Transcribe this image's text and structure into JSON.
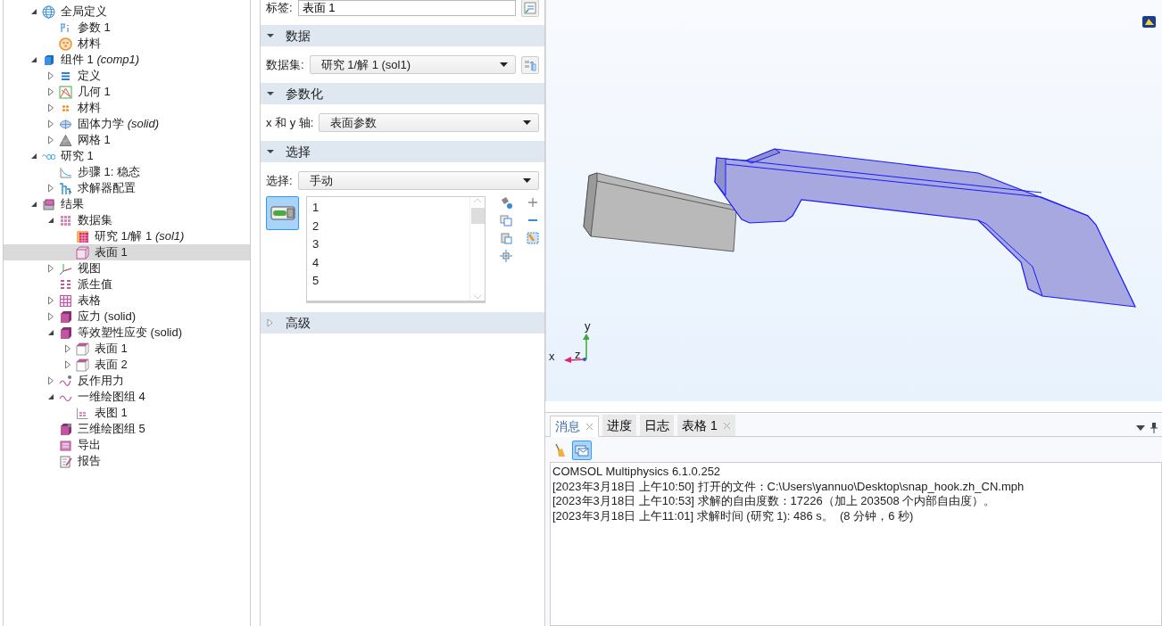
{
  "tree": [
    {
      "label": "全局定义",
      "kind": "globe",
      "expanded": true,
      "selected": false,
      "children": [
        {
          "label": "参数 1",
          "kind": "param",
          "selected": false
        },
        {
          "label": "材料",
          "kind": "material",
          "selected": false
        }
      ]
    },
    {
      "label": "组件 1 *(comp1)*",
      "kind": "component",
      "expanded": true,
      "selected": false,
      "children": [
        {
          "label": "定义",
          "kind": "definitions",
          "expanded": false,
          "selected": false
        },
        {
          "label": "几何 1",
          "kind": "geometry",
          "expanded": false,
          "selected": false
        },
        {
          "label": "材料",
          "kind": "materials",
          "expanded": false,
          "selected": false
        },
        {
          "label": "固体力学 *(solid)*",
          "kind": "physics",
          "expanded": false,
          "selected": false
        },
        {
          "label": "网格 1",
          "kind": "mesh",
          "expanded": false,
          "selected": false
        }
      ]
    },
    {
      "label": "研究 1",
      "kind": "study",
      "expanded": true,
      "selected": false,
      "children": [
        {
          "label": "步骤 1: 稳态",
          "kind": "step",
          "selected": false
        },
        {
          "label": "求解器配置",
          "kind": "solver",
          "expanded": false,
          "selected": false
        }
      ]
    },
    {
      "label": "结果",
      "kind": "results",
      "expanded": true,
      "selected": false,
      "children": [
        {
          "label": "数据集",
          "kind": "datasets",
          "expanded": true,
          "selected": false,
          "children": [
            {
              "label": "研究 1/解 1 *(sol1)*",
              "kind": "solution",
              "selected": false
            },
            {
              "label": "表面 1",
              "kind": "surface",
              "selected": true
            }
          ]
        },
        {
          "label": "视图",
          "kind": "view",
          "expanded": false,
          "selected": false
        },
        {
          "label": "派生值",
          "kind": "derived",
          "selected": false
        },
        {
          "label": "表格",
          "kind": "table",
          "expanded": false,
          "selected": false
        },
        {
          "label": "应力 (solid)",
          "kind": "plot3d",
          "expanded": false,
          "selected": false
        },
        {
          "label": "等效塑性应变 (solid)",
          "kind": "plot3d",
          "expanded": true,
          "selected": false,
          "children": [
            {
              "label": "表面 1",
              "kind": "surfaceplot",
              "expanded": false,
              "selected": false
            },
            {
              "label": "表面 2",
              "kind": "surfaceplot",
              "expanded": false,
              "selected": false
            }
          ]
        },
        {
          "label": "反作用力",
          "kind": "plot1dnew",
          "expanded": false,
          "selected": false
        },
        {
          "label": "一维绘图组 4",
          "kind": "plot1d",
          "expanded": true,
          "selected": false,
          "children": [
            {
              "label": "表图 1",
              "kind": "tableplot",
              "selected": false
            }
          ]
        },
        {
          "label": "三维绘图组 5",
          "kind": "plot3dnew",
          "selected": false
        },
        {
          "label": "导出",
          "kind": "export",
          "selected": false
        },
        {
          "label": "报告",
          "kind": "report",
          "selected": false
        }
      ]
    }
  ],
  "settings": {
    "label_field": {
      "label": "标签:",
      "value": "表面 1"
    },
    "sections": [
      {
        "title": "数据",
        "expanded": true,
        "rows": [
          {
            "kind": "select",
            "label": "数据集:",
            "value": "研究 1/解 1 (sol1)",
            "button": true
          }
        ]
      },
      {
        "title": "参数化",
        "expanded": true,
        "rows": [
          {
            "kind": "select",
            "label": "x 和 y 轴:",
            "value": "表面参数",
            "button": false
          }
        ]
      },
      {
        "title": "选择",
        "expanded": true,
        "rows": [
          {
            "kind": "select",
            "label": "选择:",
            "value": "手动",
            "button": false
          },
          {
            "kind": "entity-list",
            "active": true,
            "items": [
              "1",
              "2",
              "3",
              "4",
              "5"
            ]
          }
        ]
      },
      {
        "title": "高级",
        "expanded": false
      }
    ]
  },
  "viewport": {
    "axes": {
      "x": "x",
      "y": "y",
      "z": "z"
    }
  },
  "messages": {
    "tabs": [
      {
        "label": "消息",
        "selected": true,
        "closable": true
      },
      {
        "label": "进度",
        "selected": false,
        "closable": false
      },
      {
        "label": "日志",
        "selected": false,
        "closable": false
      },
      {
        "label": "表格 1",
        "selected": false,
        "closable": true
      }
    ],
    "tools": [
      {
        "kind": "clear",
        "active": false
      },
      {
        "kind": "messages",
        "active": true
      }
    ],
    "lines": [
      "COMSOL Multiphysics 6.1.0.252",
      "[2023年3月18日 上午10:50] 打开的文件：C:\\Users\\yannuo\\Desktop\\snap_hook.zh_CN.mph",
      "[2023年3月18日 上午10:53] 求解的自由度数：17226（加上 203508 个内部自由度）。",
      "[2023年3月18日 上午11:01] 求解时间 (研究 1): 486 s。  (8 分钟，6 秒)"
    ]
  }
}
